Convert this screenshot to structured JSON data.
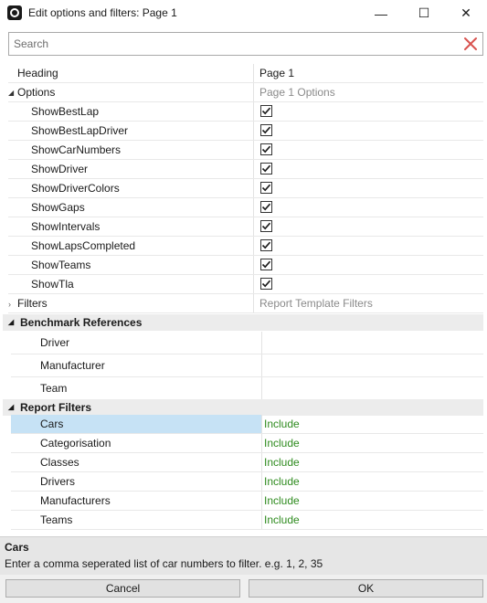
{
  "window": {
    "title": "Edit options and filters: Page 1",
    "controls": {
      "minimize": "—",
      "maximize": "☐",
      "close": "✕"
    }
  },
  "search": {
    "placeholder": "Search",
    "value": ""
  },
  "grid": {
    "heading_label": "Heading",
    "heading_value": "Page 1",
    "options": {
      "label": "Options",
      "value": "Page 1 Options",
      "items": [
        {
          "label": "ShowBestLap",
          "checked": true
        },
        {
          "label": "ShowBestLapDriver",
          "checked": true
        },
        {
          "label": "ShowCarNumbers",
          "checked": true
        },
        {
          "label": "ShowDriver",
          "checked": true
        },
        {
          "label": "ShowDriverColors",
          "checked": true
        },
        {
          "label": "ShowGaps",
          "checked": true
        },
        {
          "label": "ShowIntervals",
          "checked": true
        },
        {
          "label": "ShowLapsCompleted",
          "checked": true
        },
        {
          "label": "ShowTeams",
          "checked": true
        },
        {
          "label": "ShowTla",
          "checked": true
        }
      ]
    },
    "filters": {
      "label": "Filters",
      "value": "Report Template Filters"
    },
    "benchmark": {
      "label": "Benchmark References",
      "items": [
        {
          "label": "Driver",
          "value": ""
        },
        {
          "label": "Manufacturer",
          "value": ""
        },
        {
          "label": "Team",
          "value": ""
        }
      ]
    },
    "report_filters": {
      "label": "Report Filters",
      "items": [
        {
          "label": "Cars",
          "value": "Include",
          "selected": true
        },
        {
          "label": "Categorisation",
          "value": "Include"
        },
        {
          "label": "Classes",
          "value": "Include"
        },
        {
          "label": "Drivers",
          "value": "Include"
        },
        {
          "label": "Manufacturers",
          "value": "Include"
        },
        {
          "label": "Teams",
          "value": "Include"
        }
      ]
    }
  },
  "description": {
    "title": "Cars",
    "text": "Enter a comma seperated list of car numbers to filter. e.g. 1, 2, 35"
  },
  "buttons": {
    "cancel": "Cancel",
    "ok": "OK"
  },
  "colors": {
    "include_green": "#2e8b1e",
    "selection_blue": "#c6e2f5",
    "clear_red": "#d9534f"
  }
}
